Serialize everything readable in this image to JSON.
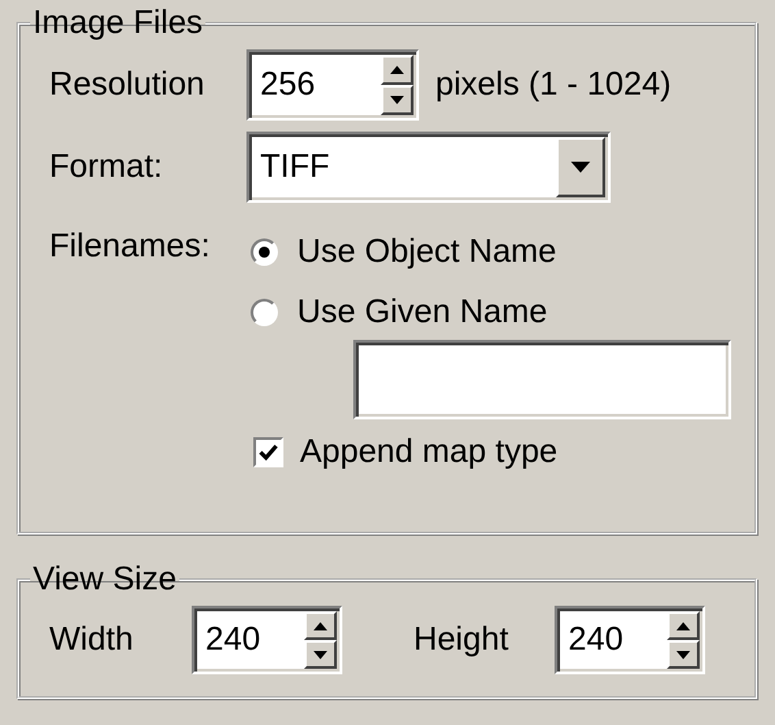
{
  "image_files": {
    "title": "Image Files",
    "resolution": {
      "label": "Resolution",
      "value": "256",
      "range": "pixels (1 - 1024)"
    },
    "format": {
      "label": "Format:",
      "value": "TIFF"
    },
    "filenames": {
      "label": "Filenames:",
      "options": [
        {
          "label": "Use Object Name",
          "selected": true
        },
        {
          "label": "Use Given Name",
          "selected": false
        }
      ]
    },
    "append_map_type": {
      "label": "Append map type",
      "checked": true
    }
  },
  "view_size": {
    "title": "View Size",
    "width": {
      "label": "Width",
      "value": "240"
    },
    "height": {
      "label": "Height",
      "value": "240"
    }
  }
}
